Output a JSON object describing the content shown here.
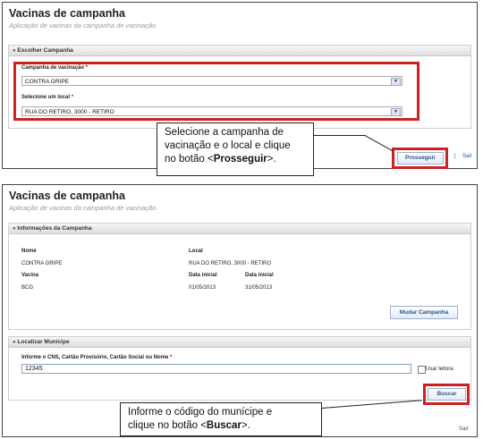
{
  "screen1": {
    "title": "Vacinas de campanha",
    "subtitle": "Aplicação de vacinas da campanha de vacinação",
    "panel_title": "» Escolher Campanha",
    "campaign_label": "Campanha de vacinação",
    "campaign_value": "CONTRA GRIPE",
    "location_label": "Selecione um local",
    "location_value": "RUA DO RETIRO, 3000 - RETIRO",
    "required_mark": "*",
    "proceed_button": "Prosseguir",
    "link_sep": "|",
    "exit_link": "Sair",
    "callout_line1": "Selecione a campanha de",
    "callout_line2": "vacinação e o local e clique",
    "callout_line3_pre": "no botão <",
    "callout_line3_bold": "Prosseguir",
    "callout_line3_post": ">."
  },
  "screen2": {
    "title": "Vacinas de campanha",
    "subtitle": "Aplicação de vacinas da campanha de vacinação",
    "info_panel_title": "» Informações da Campanha",
    "col_nome": "Nome",
    "col_local": "Local",
    "nome_value": "CONTRA GRIPE",
    "local_value": "RUA DO RETIRO, 3000 - RETIRO",
    "col_vacina": "Vacina",
    "col_data_inicial": "Data inicial",
    "col_data_final": "Data inicial",
    "vacina_value": "BCG",
    "data_inicial_value": "01/05/2013",
    "data_final_value": "31/05/2013",
    "change_button": "Mudar Campanha",
    "search_panel_title": "» Localizar Munícipe",
    "search_label": "Informe o CNS, Cartão Provisório, Cartão Social ou Nome",
    "required_mark": "*",
    "search_value": "12345",
    "reader_label": "Usar leitora",
    "search_button": "Buscar",
    "exit_link": "Sair",
    "callout_line1": "Informe o código do munícipe e",
    "callout_line2_pre": "clique no botão <",
    "callout_line2_bold": "Buscar",
    "callout_line2_post": ">."
  },
  "colors": {
    "highlight": "#cc2222",
    "link": "#2a5593"
  }
}
